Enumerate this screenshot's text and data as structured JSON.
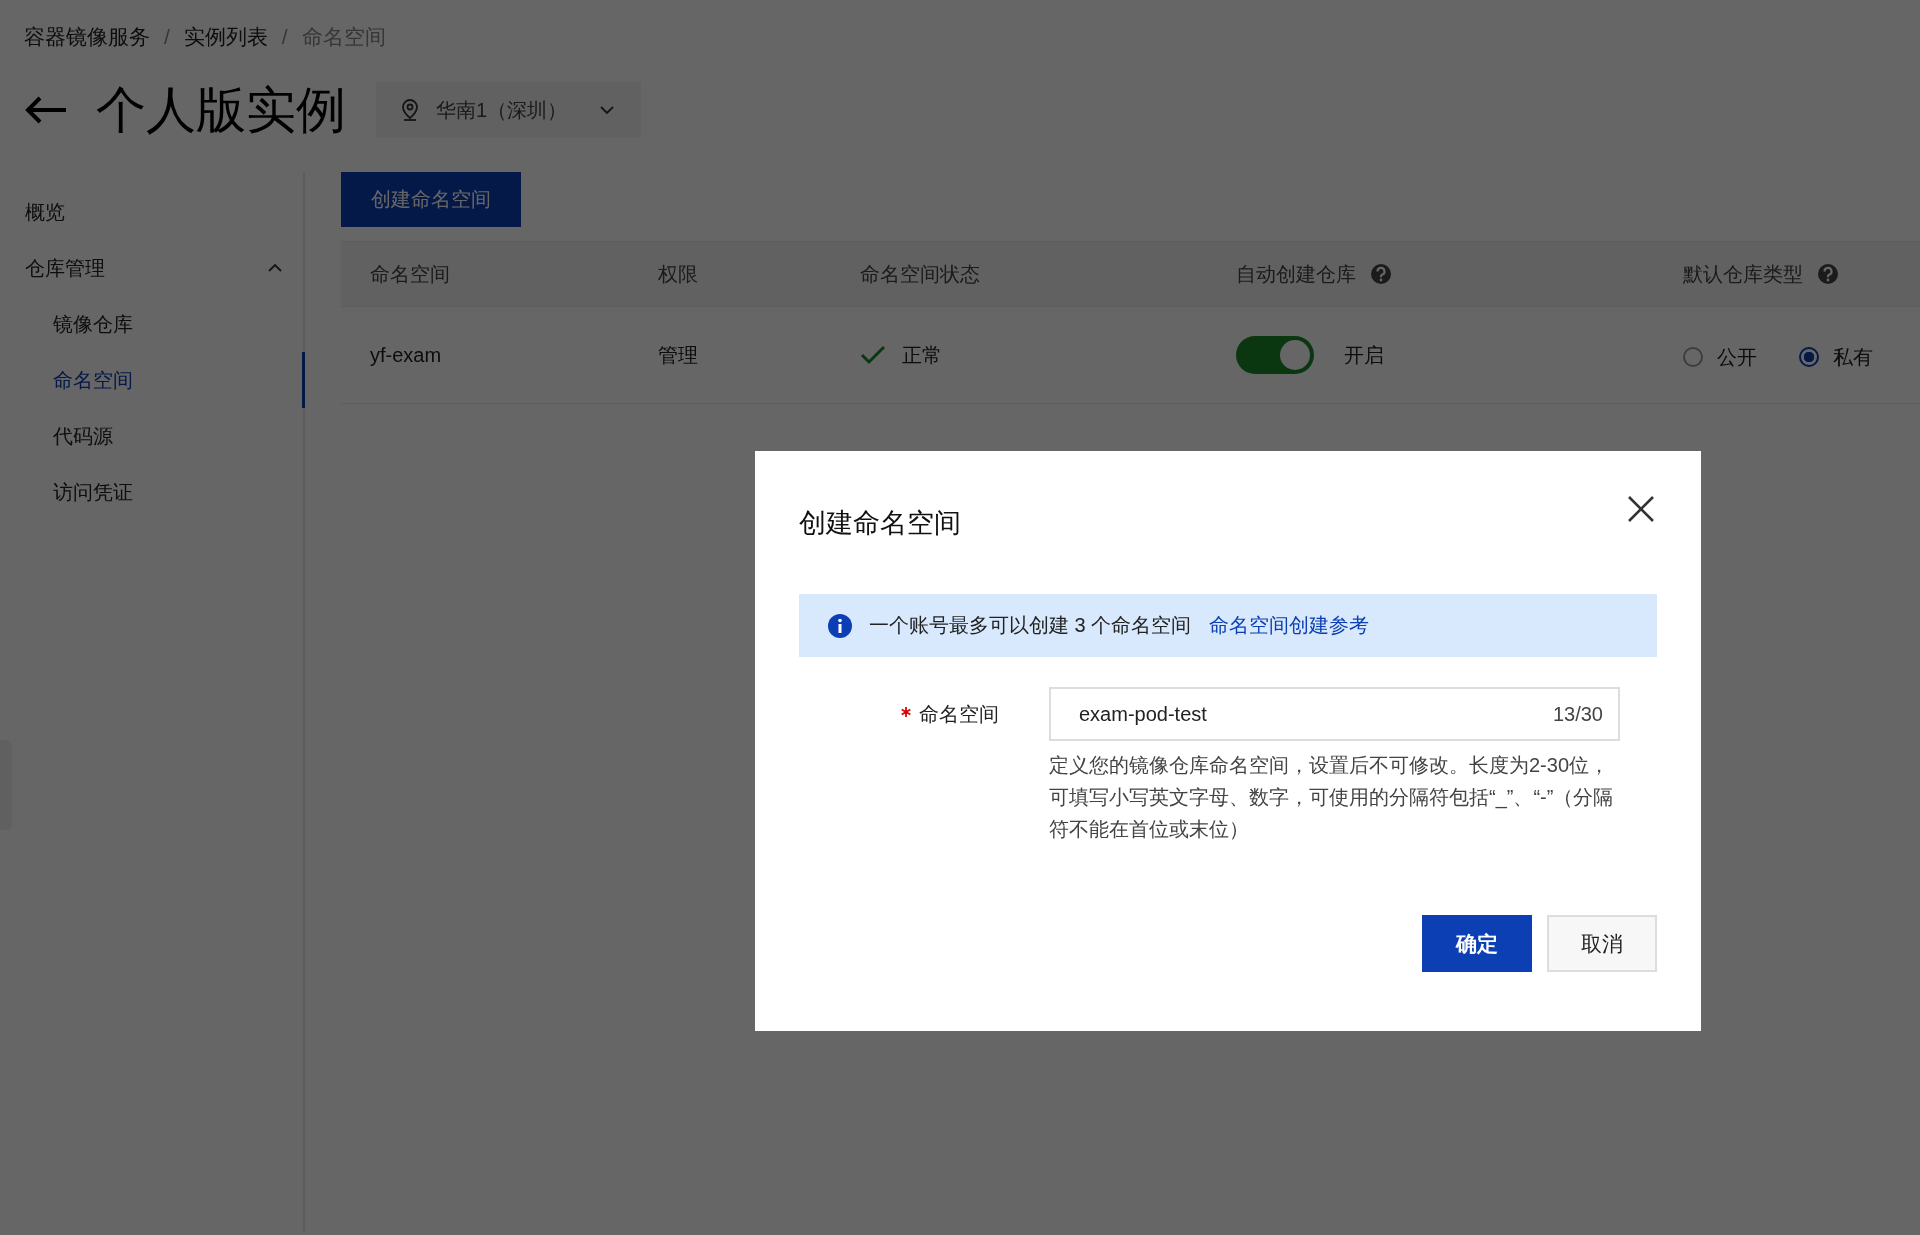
{
  "breadcrumb": [
    {
      "label": "容器镜像服务",
      "current": false
    },
    {
      "label": "实例列表",
      "current": false
    },
    {
      "label": "命名空间",
      "current": true
    }
  ],
  "breadcrumb_separator": "/",
  "page_title": "个人版实例",
  "region_select": {
    "value": "华南1（深圳）"
  },
  "sidebar": {
    "items": [
      {
        "label": "概览",
        "selected": false
      },
      {
        "label": "仓库管理",
        "selected": false,
        "expanded": true,
        "children": [
          {
            "label": "镜像仓库",
            "selected": false
          },
          {
            "label": "命名空间",
            "selected": true
          },
          {
            "label": "代码源",
            "selected": false
          },
          {
            "label": "访问凭证",
            "selected": false
          }
        ]
      }
    ]
  },
  "create_button": "创建命名空间",
  "table": {
    "columns": [
      {
        "label": "命名空间",
        "help": false
      },
      {
        "label": "权限",
        "help": false
      },
      {
        "label": "命名空间状态",
        "help": false
      },
      {
        "label": "自动创建仓库",
        "help": true
      },
      {
        "label": "默认仓库类型",
        "help": true
      }
    ],
    "rows": [
      {
        "namespace": "yf-exam",
        "permission": "管理",
        "status": {
          "text": "正常",
          "kind": "ok"
        },
        "auto_create": {
          "on": true,
          "text": "开启"
        },
        "default_type": [
          {
            "label": "公开",
            "selected": false
          },
          {
            "label": "私有",
            "selected": true
          }
        ]
      }
    ]
  },
  "dialog": {
    "title": "创建命名空间",
    "info": {
      "text": "一个账号最多可以创建 3 个命名空间",
      "link": "命名空间创建参考"
    },
    "field": {
      "label": "命名空间",
      "required": true,
      "value": "exam-pod-test",
      "counter": "13/30",
      "help": "定义您的镜像仓库命名空间，设置后不可修改。长度为2-30位，可填写小写英文字母、数字，可使用的分隔符包括“_”、“-”（分隔符不能在首位或末位）"
    },
    "buttons": [
      {
        "label": "确定",
        "kind": "primary"
      },
      {
        "label": "取消",
        "kind": "default"
      }
    ]
  }
}
